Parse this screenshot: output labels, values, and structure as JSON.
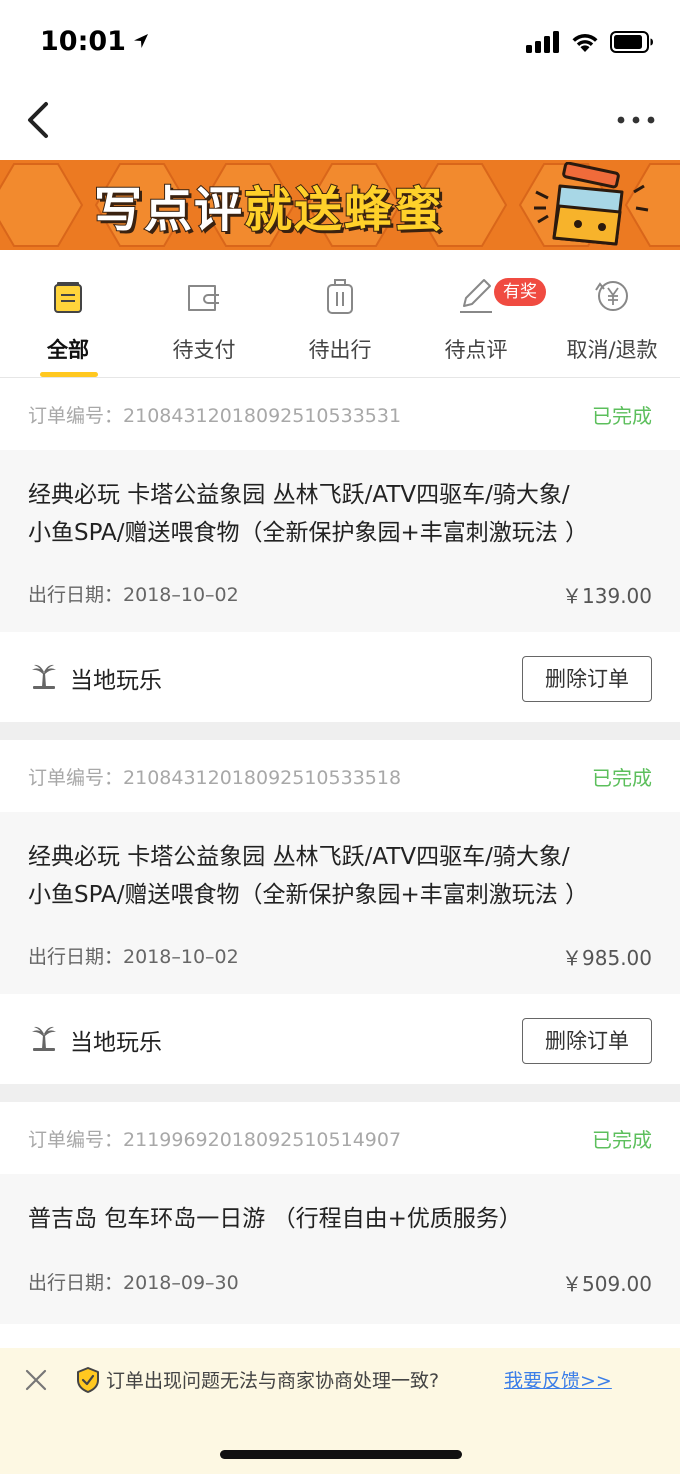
{
  "status_bar": {
    "time": "10:01"
  },
  "banner": {
    "text_white": "写点评",
    "text_yellow": "就送蜂蜜"
  },
  "tabs": [
    {
      "label": "全部",
      "icon": "order-list-icon",
      "active": true
    },
    {
      "label": "待支付",
      "icon": "wallet-icon"
    },
    {
      "label": "待出行",
      "icon": "luggage-icon"
    },
    {
      "label": "待点评",
      "icon": "pen-icon",
      "badge": "有奖"
    },
    {
      "label": "取消/退款",
      "icon": "refund-icon"
    }
  ],
  "orders": [
    {
      "order_no_label": "订单编号：",
      "order_no": "2108431201809251053353 1",
      "status": "已完成",
      "title_line1": "经典必玩 卡塔公益象园 丛林飞跃/ATV四驱车/骑大象/",
      "title_line2": "小鱼SPA/赠送喂食物（全新保护象园+丰富刺激玩法 ）",
      "date_label": "出行日期：",
      "date": "2018–10–02",
      "price": "￥139.00",
      "category": "当地玩乐",
      "action": "删除订单"
    },
    {
      "order_no_label": "订单编号：",
      "order_no": "21084312018092510533518",
      "status": "已完成",
      "title_line1": "经典必玩 卡塔公益象园 丛林飞跃/ATV四驱车/骑大象/",
      "title_line2": "小鱼SPA/赠送喂食物（全新保护象园+丰富刺激玩法 ）",
      "date_label": "出行日期：",
      "date": "2018–10–02",
      "price": "￥985.00",
      "category": "当地玩乐",
      "action": "删除订单"
    },
    {
      "order_no_label": "订单编号：",
      "order_no": "21199692018092510514907",
      "status": "已完成",
      "title_line1": "普吉岛 包车环岛一日游 （行程自由+优质服务）",
      "date_label": "出行日期：",
      "date": "2018–09–30",
      "price": "￥509.00"
    }
  ],
  "feedback": {
    "text": "订单出现问题无法与商家协商处理一致?",
    "link": "我要反馈>>"
  },
  "colors": {
    "accent_yellow": "#ffc820",
    "status_green": "#5cbf5c",
    "badge_red": "#f04b41",
    "banner_orange": "#ec7a22",
    "link_blue": "#3b7ee8"
  }
}
